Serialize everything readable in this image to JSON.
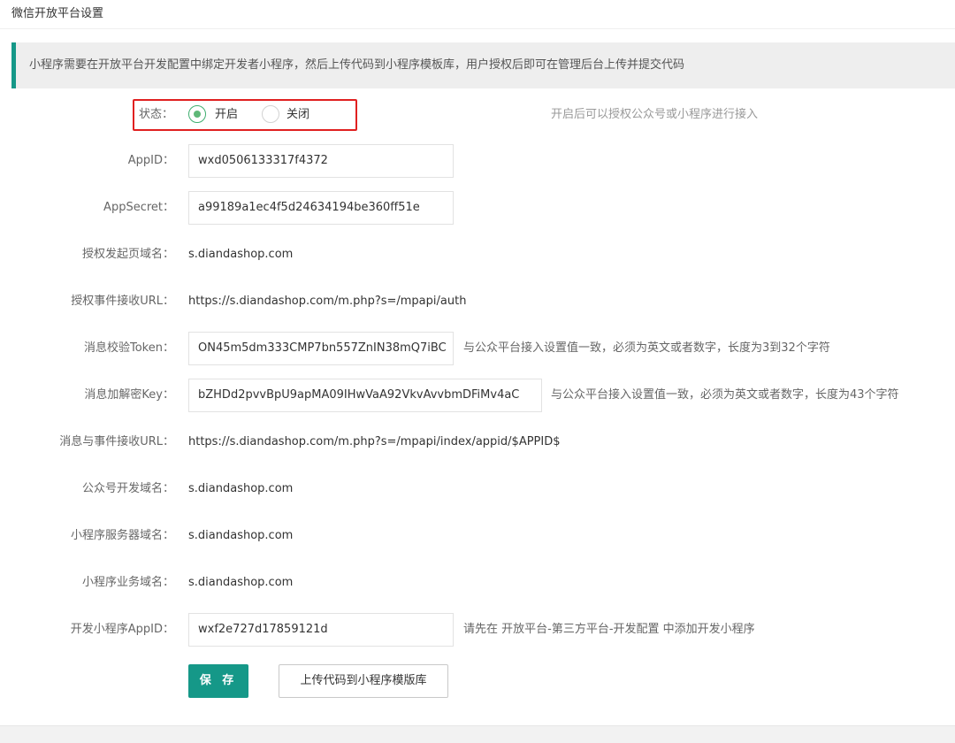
{
  "header": {
    "title": "微信开放平台设置"
  },
  "notice": {
    "text": "小程序需要在开放平台开发配置中绑定开发者小程序，然后上传代码到小程序模板库，用户授权后即可在管理后台上传并提交代码"
  },
  "status": {
    "label": "状态：",
    "options": [
      "开启",
      "关闭"
    ],
    "selected": "开启",
    "hint": "开启后可以授权公众号或小程序进行接入"
  },
  "fields": {
    "appid": {
      "label": "AppID：",
      "value": "wxd0506133317f4372"
    },
    "appsecret": {
      "label": "AppSecret：",
      "value": "a99189a1ec4f5d24634194be360ff51e"
    },
    "auth_domain": {
      "label": "授权发起页域名：",
      "value": "s.diandashop.com"
    },
    "auth_event_url": {
      "label": "授权事件接收URL：",
      "value": "https://s.diandashop.com/m.php?s=/mpapi/auth"
    },
    "token": {
      "label": "消息校验Token：",
      "value": "ON45m5dm333CMP7bn557ZnIN38mQ7iBC",
      "hint": "与公众平台接入设置值一致，必须为英文或者数字，长度为3到32个字符"
    },
    "aes_key": {
      "label": "消息加解密Key：",
      "value": "bZHDd2pvvBpU9apMA09IHwVaA92VkvAvvbmDFiMv4aC",
      "hint": "与公众平台接入设置值一致，必须为英文或者数字，长度为43个字符"
    },
    "msg_event_url": {
      "label": "消息与事件接收URL：",
      "value": "https://s.diandashop.com/m.php?s=/mpapi/index/appid/$APPID$"
    },
    "mp_dev_domain": {
      "label": "公众号开发域名：",
      "value": "s.diandashop.com"
    },
    "mini_server_domain": {
      "label": "小程序服务器域名：",
      "value": "s.diandashop.com"
    },
    "mini_business_domain": {
      "label": "小程序业务域名：",
      "value": "s.diandashop.com"
    },
    "dev_mini_appid": {
      "label": "开发小程序AppID：",
      "value": "wxf2e727d17859121d",
      "hint": "请先在 开放平台-第三方平台-开发配置 中添加开发小程序"
    }
  },
  "buttons": {
    "save": "保 存",
    "upload": "上传代码到小程序模版库"
  },
  "colors": {
    "primary": "#159888",
    "radio_checked": "#5fb878",
    "highlight_border": "#e02020"
  }
}
